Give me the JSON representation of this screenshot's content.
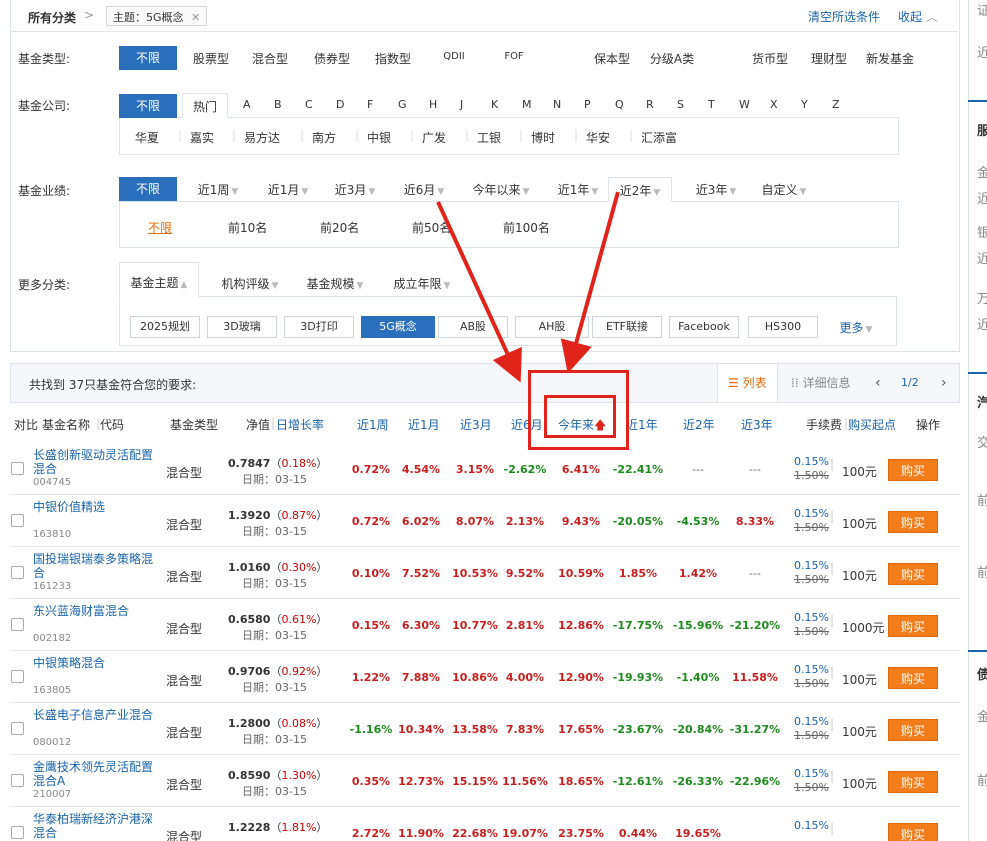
{
  "breadcrumb": {
    "title": "所有分类",
    "separator": ">",
    "tag": "主题：5G概念",
    "tag_close": "✕",
    "clear": "清空所选条件",
    "collapse": "收起"
  },
  "fund_type": {
    "label": "基金类型:",
    "options": [
      "不限",
      "股票型",
      "混合型",
      "债券型",
      "指数型",
      "QDII",
      "FOF",
      "保本型",
      "分级A类",
      "货币型",
      "理财型",
      "新发基金"
    ]
  },
  "fund_company": {
    "label": "基金公司:",
    "tabs": [
      "不限",
      "热门"
    ],
    "letters": [
      "A",
      "B",
      "C",
      "D",
      "F",
      "G",
      "H",
      "J",
      "K",
      "M",
      "N",
      "P",
      "Q",
      "R",
      "S",
      "T",
      "W",
      "X",
      "Y",
      "Z"
    ],
    "companies": [
      "华夏",
      "嘉实",
      "易方达",
      "南方",
      "中银",
      "广发",
      "工银",
      "博时",
      "华安",
      "汇添富"
    ]
  },
  "performance": {
    "label": "基金业绩:",
    "periods": [
      "不限",
      "近1周",
      "近1月",
      "近3月",
      "近6月",
      "今年以来",
      "近1年",
      "近2年",
      "近3年",
      "自定义"
    ],
    "ranks": [
      "不限",
      "前10名",
      "前20名",
      "前50名",
      "前100名"
    ]
  },
  "more": {
    "label": "更多分类:",
    "tabs": [
      "基金主题",
      "机构评级",
      "基金规模",
      "成立年限"
    ],
    "themes": [
      "2025规划",
      "3D玻璃",
      "3D打印",
      "5G概念",
      "AB股",
      "AH股",
      "ETF联接",
      "Facebook",
      "HS300"
    ],
    "more_link": "更多"
  },
  "results": {
    "count_text": "共找到 37只基金符合您的要求:",
    "view_list": "列表",
    "view_detail": "详细信息",
    "page": "1/2",
    "prev": "‹",
    "next": "›"
  },
  "table": {
    "headers": {
      "compare": "对比",
      "name": "基金名称",
      "code": "代码",
      "type": "基金类型",
      "nav": "净值",
      "daily": "日增长率",
      "w1": "近1周",
      "m1": "近1月",
      "m3": "近3月",
      "m6": "近6月",
      "ytd": "今年来",
      "y1": "近1年",
      "y2": "近2年",
      "y3": "近3年",
      "fee": "手续费",
      "minbuy": "购买起点",
      "action": "操作"
    },
    "rows": [
      {
        "name": "长盛创新驱动灵活配置混合",
        "code": "004745",
        "type": "混合型",
        "nav": "0.7847",
        "pct": "0.18%",
        "date": "日期：03-15",
        "w1": "0.72%",
        "m1": "4.54%",
        "m3": "3.15%",
        "m6": "-2.62%",
        "ytd": "6.41%",
        "y1": "-22.41%",
        "y2": "---",
        "y3": "---",
        "fee": "0.15%",
        "fee_orig": "1.50%",
        "minbuy": "100元",
        "buy": "购买"
      },
      {
        "name": "中银价值精选",
        "code": "163810",
        "type": "混合型",
        "nav": "1.3920",
        "pct": "0.87%",
        "date": "日期：03-15",
        "w1": "0.72%",
        "m1": "6.02%",
        "m3": "8.07%",
        "m6": "2.13%",
        "ytd": "9.43%",
        "y1": "-20.05%",
        "y2": "-4.53%",
        "y3": "8.33%",
        "fee": "0.15%",
        "fee_orig": "1.50%",
        "minbuy": "100元",
        "buy": "购买"
      },
      {
        "name": "国投瑞银瑞泰多策略混合",
        "code": "161233",
        "type": "混合型",
        "nav": "1.0160",
        "pct": "0.30%",
        "date": "日期：03-15",
        "w1": "0.10%",
        "m1": "7.52%",
        "m3": "10.53%",
        "m6": "9.52%",
        "ytd": "10.59%",
        "y1": "1.85%",
        "y2": "1.42%",
        "y3": "---",
        "fee": "0.15%",
        "fee_orig": "1.50%",
        "minbuy": "100元",
        "buy": "购买"
      },
      {
        "name": "东兴蓝海财富混合",
        "code": "002182",
        "type": "混合型",
        "nav": "0.6580",
        "pct": "0.61%",
        "date": "日期：03-15",
        "w1": "0.15%",
        "m1": "6.30%",
        "m3": "10.77%",
        "m6": "2.81%",
        "ytd": "12.86%",
        "y1": "-17.75%",
        "y2": "-15.96%",
        "y3": "-21.20%",
        "fee": "0.15%",
        "fee_orig": "1.50%",
        "minbuy": "1000元",
        "buy": "购买"
      },
      {
        "name": "中银策略混合",
        "code": "163805",
        "type": "混合型",
        "nav": "0.9706",
        "pct": "0.92%",
        "date": "日期：03-15",
        "w1": "1.22%",
        "m1": "7.88%",
        "m3": "10.86%",
        "m6": "4.00%",
        "ytd": "12.90%",
        "y1": "-19.93%",
        "y2": "-1.40%",
        "y3": "11.58%",
        "fee": "0.15%",
        "fee_orig": "1.50%",
        "minbuy": "100元",
        "buy": "购买"
      },
      {
        "name": "长盛电子信息产业混合",
        "code": "080012",
        "type": "混合型",
        "nav": "1.2800",
        "pct": "0.08%",
        "date": "日期：03-15",
        "w1": "-1.16%",
        "m1": "10.34%",
        "m3": "13.58%",
        "m6": "7.83%",
        "ytd": "17.65%",
        "y1": "-23.67%",
        "y2": "-20.84%",
        "y3": "-31.27%",
        "fee": "0.15%",
        "fee_orig": "1.50%",
        "minbuy": "100元",
        "buy": "购买"
      },
      {
        "name": "金鹰技术领先灵活配置混合A",
        "code": "210007",
        "type": "混合型",
        "nav": "0.8590",
        "pct": "1.30%",
        "date": "日期：03-15",
        "w1": "0.35%",
        "m1": "12.73%",
        "m3": "15.15%",
        "m6": "11.56%",
        "ytd": "18.65%",
        "y1": "-12.61%",
        "y2": "-26.33%",
        "y3": "-22.96%",
        "fee": "0.15%",
        "fee_orig": "1.50%",
        "minbuy": "100元",
        "buy": "购买"
      },
      {
        "name": "华泰柏瑞新经济沪港深混合",
        "code": "",
        "type": "混合型",
        "nav": "1.2228",
        "pct": "1.81%",
        "date": "",
        "w1": "2.72%",
        "m1": "11.90%",
        "m3": "22.68%",
        "m6": "19.07%",
        "ytd": "23.75%",
        "y1": "0.44%",
        "y2": "19.65%",
        "y3": "",
        "fee": "0.15%",
        "fee_orig": "",
        "minbuy": "",
        "buy": "购买"
      }
    ]
  },
  "sidebar": {
    "chars": [
      "证",
      "近",
      "服",
      "金",
      "近",
      "银",
      "近",
      "万",
      "近",
      "汽",
      "交",
      "前",
      "前",
      "债",
      "金",
      "前"
    ]
  },
  "colors": {
    "accent": "#2a6fbb",
    "link": "#1a63a8",
    "buy": "#f27d1a",
    "up": "#c81e1e",
    "down": "#1e8a1e",
    "annotation": "#e0241b"
  }
}
